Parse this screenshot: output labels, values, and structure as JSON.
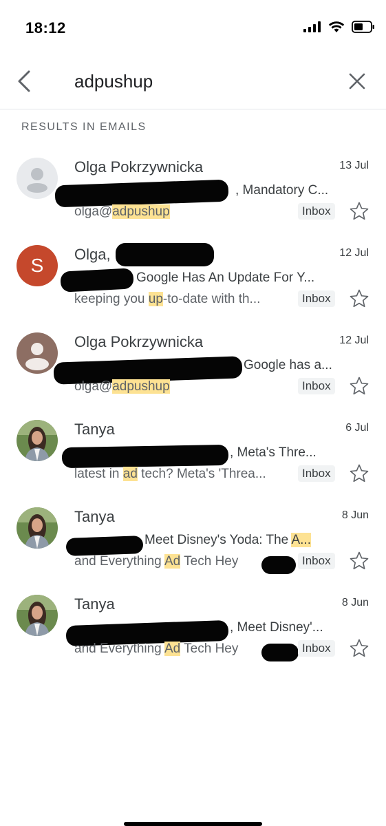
{
  "status": {
    "time": "18:12"
  },
  "search": {
    "query": "adpushup"
  },
  "section_title": "RESULTS IN EMAILS",
  "emails": [
    {
      "sender": "Olga Pokrzywnicka",
      "date": "13 Jul",
      "subject": ", Mandatory C...",
      "snippet_pre": "olga@",
      "snippet_hl": "adpushup",
      "snippet_post": "",
      "label": "Inbox",
      "avatar": "default-person-grey-icon"
    },
    {
      "sender": "Olga,",
      "date": "12 Jul",
      "subject": "Google Has An Update For Y...",
      "snippet_pre": "keeping you ",
      "snippet_hl": "up",
      "snippet_post": "-to-date with th...",
      "label": "Inbox",
      "avatar": "S",
      "avatar_color": "#c5482c"
    },
    {
      "sender": "Olga Pokrzywnicka",
      "date": "12 Jul",
      "subject": "Google has a...",
      "snippet_pre": "olga@",
      "snippet_hl": "adpushup",
      "snippet_post": "",
      "label": "Inbox",
      "avatar": "default-person-brown-icon"
    },
    {
      "sender": "Tanya",
      "date": "6 Jul",
      "subject": ",  Meta's Thre...",
      "snippet_pre": "latest in ",
      "snippet_hl": "ad",
      "snippet_post": " tech? Meta's 'Threa...",
      "label": "Inbox",
      "avatar": "photo"
    },
    {
      "sender": "Tanya",
      "date": "8 Jun",
      "subject_pre": "Meet Disney's Yoda: The ",
      "subject_hl": "A...",
      "snippet_pre": "and Everything ",
      "snippet_hl": "Ad",
      "snippet_post": " Tech Hey",
      "label": "Inbox",
      "avatar": "photo"
    },
    {
      "sender": "Tanya",
      "date": "8 Jun",
      "subject": ", Meet Disney'...",
      "snippet_pre": "and Everything ",
      "snippet_hl": "Ad",
      "snippet_post": " Tech Hey",
      "label": "Inbox",
      "avatar": "photo"
    }
  ],
  "colors": {
    "highlight": "#fde293",
    "accent": "#c5482c"
  }
}
